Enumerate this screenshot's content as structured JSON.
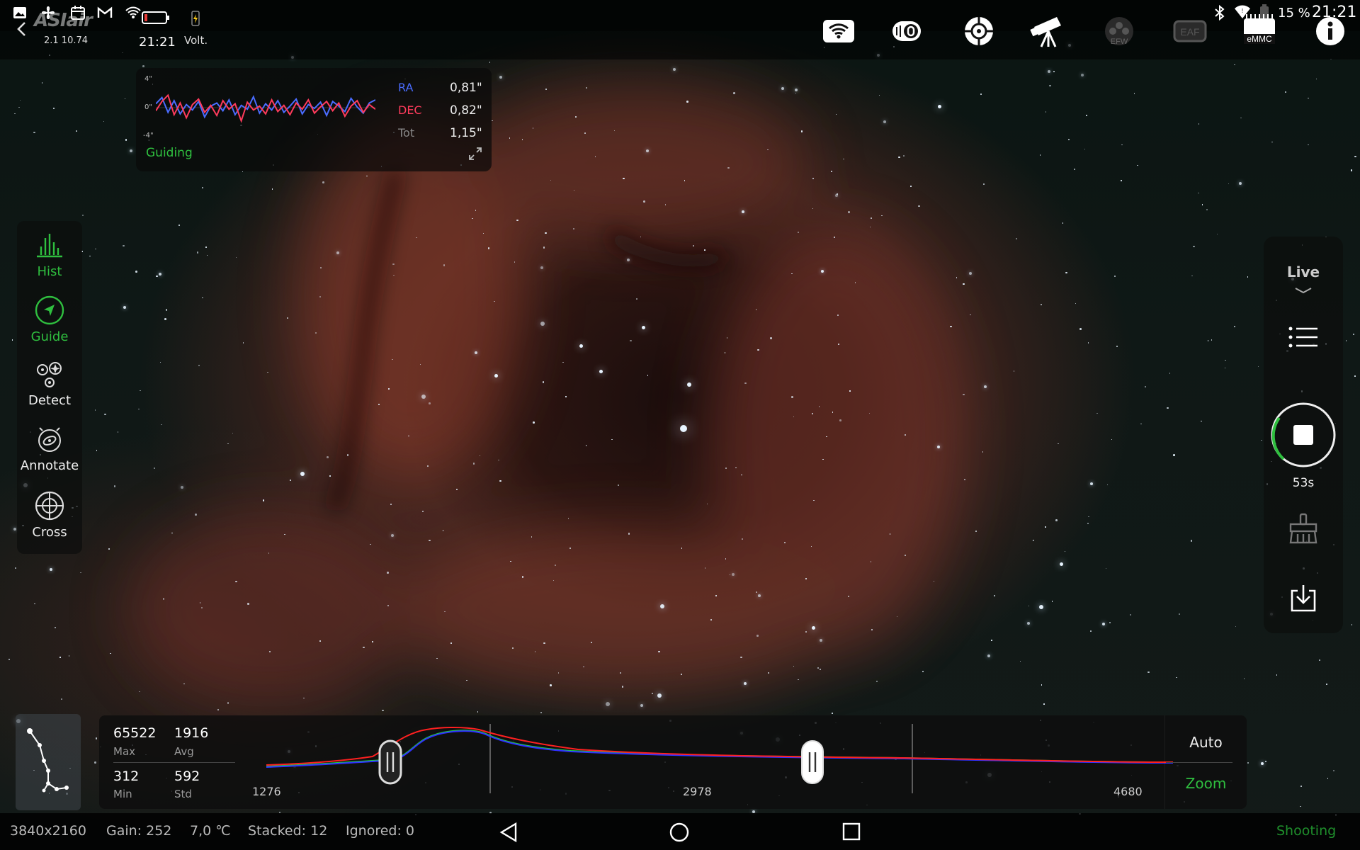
{
  "status_bar": {
    "time": "21:21",
    "battery": "15 %",
    "icons": [
      "image-icon",
      "fan-icon",
      "calendar-icon",
      "gmail-icon",
      "wifi-icon",
      "battery-icon",
      "charging-icon",
      "bluetooth-icon",
      "signal-icon",
      "battery-level-icon"
    ]
  },
  "app": {
    "logo": "ASIair",
    "version": "2.1 10.74",
    "clock": "21:21",
    "volt_label": "Volt."
  },
  "toolbar_icons": [
    "wifi-icon",
    "focuser-icon",
    "guide-camera-icon",
    "telescope-icon",
    "efw-icon",
    "eaf-icon",
    "emmc-icon",
    "info-icon"
  ],
  "toolbar_labels": {
    "efw": "EFW",
    "eaf": "EAF",
    "emmc": "eMMC"
  },
  "guiding": {
    "axis_top": "4\"",
    "axis_mid": "0\"",
    "axis_bottom": "-4\"",
    "ra_label": "RA",
    "ra_value": "0,81\"",
    "dec_label": "DEC",
    "dec_value": "0,82\"",
    "tot_label": "Tot",
    "tot_value": "1,15\"",
    "status": "Guiding",
    "ra_color": "#4a6cff",
    "dec_color": "#ff3b5c",
    "ra_series": [
      0.5,
      1.3,
      -0.6,
      0.9,
      -0.8,
      0.4,
      -0.3,
      0.8,
      -1.2,
      0.2,
      0.6,
      -0.4,
      1.0,
      -0.9,
      0.3,
      -0.2,
      1.4,
      -0.7,
      0.5,
      -0.3,
      0.9,
      -0.6,
      0.2,
      1.1,
      -0.8,
      0.4,
      -0.1,
      0.7,
      -1.0,
      0.8,
      0.2,
      -0.5,
      1.2,
      0.1,
      -0.7,
      0.6,
      1.0
    ],
    "dec_series": [
      -0.4,
      0.8,
      1.6,
      -0.9,
      0.6,
      -1.3,
      0.4,
      1.1,
      -0.6,
      0.3,
      -1.0,
      0.9,
      -0.2,
      0.5,
      -1.7,
      0.7,
      -0.3,
      0.2,
      -0.8,
      1.0,
      -0.5,
      0.3,
      -0.9,
      0.6,
      -0.2,
      1.0,
      -0.7,
      0.1,
      0.8,
      -0.4,
      0.6,
      -1.1,
      0.2,
      0.9,
      -0.6,
      0.4,
      -0.2
    ]
  },
  "left_tools": [
    {
      "label": "Hist",
      "icon": "histogram-icon",
      "active": true
    },
    {
      "label": "Guide",
      "icon": "guide-icon",
      "active": true
    },
    {
      "label": "Detect",
      "icon": "detect-stars-icon",
      "active": false
    },
    {
      "label": "Annotate",
      "icon": "annotate-icon",
      "active": false
    },
    {
      "label": "Cross",
      "icon": "crosshair-icon",
      "active": false
    }
  ],
  "right_panel": {
    "mode": "Live",
    "exposure_remaining": "53s",
    "icons": [
      "chevron-down-icon",
      "menu-list-icon",
      "stop-icon",
      "clear-stack-icon",
      "download-icon"
    ]
  },
  "histogram": {
    "max_value": "65522",
    "max_label": "Max",
    "avg_value": "1916",
    "avg_label": "Avg",
    "min_value": "312",
    "min_label": "Min",
    "std_value": "592",
    "std_label": "Std",
    "x_left": "1276",
    "x_mid": "2978",
    "x_right": "4680",
    "auto_label": "Auto",
    "zoom_label": "Zoom"
  },
  "bottom_bar": {
    "resolution": "3840x2160",
    "gain": "Gain: 252",
    "temperature": "7,0 ℃",
    "stacked": "Stacked: 12",
    "ignored": "Ignored: 0",
    "status": "Shooting"
  },
  "colors": {
    "accent_green": "#2fbf3f",
    "histogram_red": "#ff2020",
    "histogram_green": "#20d040",
    "histogram_blue": "#3030ff"
  }
}
